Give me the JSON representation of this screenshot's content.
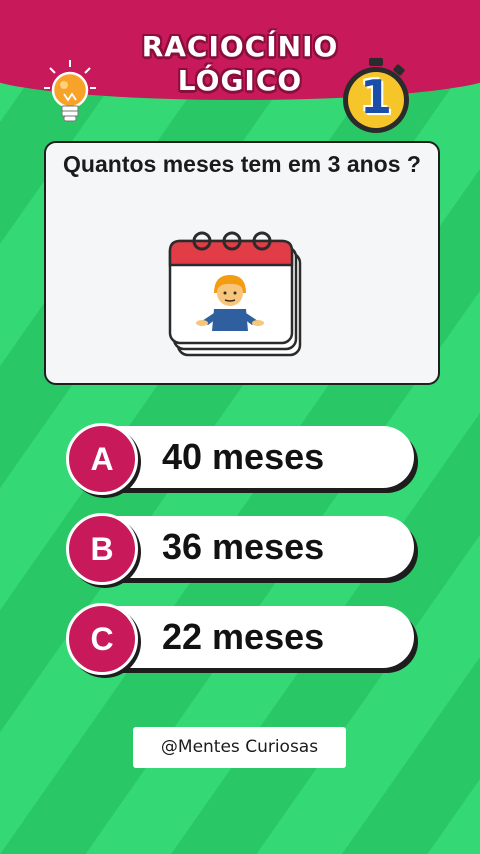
{
  "header": {
    "title_line1": "RACIOCÍNIO",
    "title_line2": "LÓGICO",
    "timer_value": "1",
    "brand_color": "#c8195a"
  },
  "question": {
    "text": "Quantos meses tem em 3 anos ?",
    "illustration": "calendar-with-shrugging-person-icon"
  },
  "options": [
    {
      "letter": "A",
      "text": "40 meses"
    },
    {
      "letter": "B",
      "text": "36 meses"
    },
    {
      "letter": "C",
      "text": "22 meses"
    }
  ],
  "footer": {
    "credit": "@Mentes Curiosas"
  },
  "icons": [
    "lightbulb-icon",
    "stopwatch-icon",
    "calendar-icon",
    "shrugging-person-icon"
  ],
  "colors": {
    "background": "#2fd46f",
    "accent": "#c8195a",
    "timer": "#f6c52a"
  }
}
